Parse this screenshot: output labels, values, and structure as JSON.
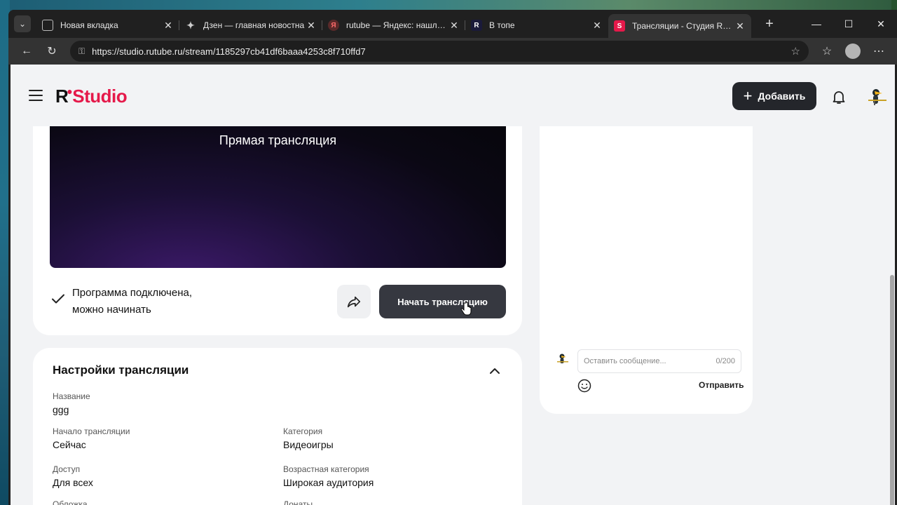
{
  "browser": {
    "tabs": [
      {
        "title": "Новая вкладка",
        "favicon": "",
        "active": false
      },
      {
        "title": "Дзен — главная новостна",
        "favicon": "",
        "active": false
      },
      {
        "title": "rutube — Яндекс: нашлось",
        "favicon": "Я",
        "active": false
      },
      {
        "title": "В топе",
        "favicon": "R",
        "active": false
      },
      {
        "title": "Трансляции - Студия RUTUBE",
        "favicon": "S",
        "active": true
      }
    ],
    "url": "https://studio.rutube.ru/stream/1185297cb41df6baaa4253c8f710ffd7"
  },
  "header": {
    "logo_r": "R",
    "logo_studio": "Studio",
    "add_label": "Добавить"
  },
  "stream": {
    "preview_title": "Прямая трансляция",
    "status_line1": "Программа подключена,",
    "status_line2": "можно начинать",
    "start_label": "Начать трансляцию"
  },
  "settings": {
    "title": "Настройки трансляции",
    "fields": [
      {
        "label": "Название",
        "value": "ggg"
      },
      {
        "label": "Начало трансляции",
        "value": "Сейчас"
      },
      {
        "label": "Категория",
        "value": "Видеоигры"
      },
      {
        "label": "Доступ",
        "value": "Для всех"
      },
      {
        "label": "Возрастная категория",
        "value": "Широкая аудитория"
      },
      {
        "label": "Обложка",
        "value": ""
      },
      {
        "label": "Донаты",
        "value": ""
      }
    ]
  },
  "chat": {
    "placeholder": "Оставить сообщение...",
    "counter": "0/200",
    "send_label": "Отправить"
  },
  "colors": {
    "brand": "#e5194a",
    "button_dark": "#24262b"
  }
}
